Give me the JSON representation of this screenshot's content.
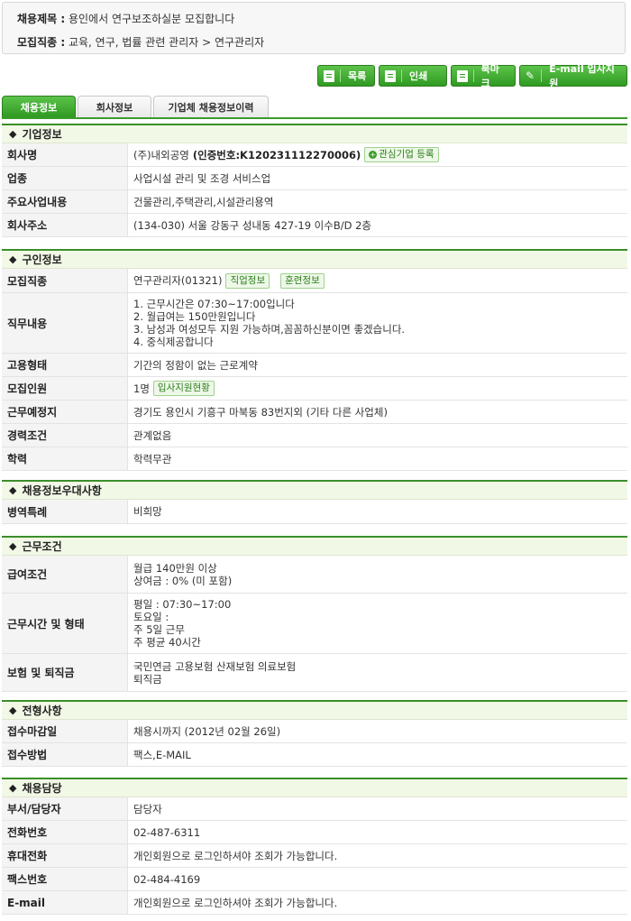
{
  "header": {
    "title_label": "채용제목 :",
    "title_value": "용인에서 연구보조하실분 모집합니다",
    "category_label": "모집직종 :",
    "category_value": "교육, 연구, 법률 관련 관리자 > 연구관리자"
  },
  "toolbar": {
    "list": "목록",
    "print": "인쇄",
    "bookmark": "북마크",
    "email_apply": "E-mail 입사지원"
  },
  "tabs": [
    "채용정보",
    "회사정보",
    "기업체 채용정보이력"
  ],
  "company": {
    "heading": "기업정보",
    "name_label": "회사명",
    "name_value": "(주)내외공영",
    "cert_no": "(인증번호:K120231112270006)",
    "fav_btn": "관심기업 등록",
    "industry_label": "업종",
    "industry_value": "사업시설 관리 및 조경 서비스업",
    "business_label": "주요사업내용",
    "business_value": "건물관리,주택관리,시설관리용역",
    "address_label": "회사주소",
    "address_value": "(134-030) 서울 강동구 성내동 427-19 이수B/D 2층"
  },
  "recruit": {
    "heading": "구인정보",
    "job_label": "모집직종",
    "job_value": "연구관리자(01321)",
    "job_tag1": "직업정보",
    "job_tag2": "훈련정보",
    "duty_label": "직무내용",
    "duty_lines": [
      "1. 근무시간은 07:30~17:00입니다",
      "2. 월급여는 150만원입니다",
      "3. 남성과 여성모두 지원 가능하며,꼼꼼하신분이면 좋겠습니다.",
      "4. 중식제공합니다"
    ],
    "type_label": "고용형태",
    "type_value": "기간의 정함이 없는 근로계약",
    "count_label": "모집인원",
    "count_value": "1명",
    "count_tag": "입사지원현황",
    "place_label": "근무예정지",
    "place_value": "경기도 용인시 기흥구 마북동 83번지외 (기타 다른 사업체)",
    "career_label": "경력조건",
    "career_value": "관계없음",
    "edu_label": "학력",
    "edu_value": "학력무관"
  },
  "prefer": {
    "heading": "채용정보우대사항",
    "military_label": "병역특례",
    "military_value": "비희망"
  },
  "work": {
    "heading": "근무조건",
    "pay_label": "급여조건",
    "pay_lines": [
      "월급 140만원 이상",
      "상여금 : 0% (미 포함)"
    ],
    "hours_label": "근무시간 및 형태",
    "hours_lines": [
      "평일 : 07:30~17:00",
      "토요일 :",
      "주 5일 근무",
      "주 평균 40시간"
    ],
    "ins_label": "보험 및 퇴직금",
    "ins_lines": [
      "국민연금 고용보험 산재보험 의료보험",
      "퇴직금"
    ]
  },
  "process": {
    "heading": "전형사항",
    "deadline_label": "접수마감일",
    "deadline_value": "채용시까지 (2012년 02월 26일)",
    "method_label": "접수방법",
    "method_value": "팩스,E-MAIL"
  },
  "contact": {
    "heading": "채용담당",
    "dept_label": "부서/담당자",
    "dept_value": "담당자",
    "phone_label": "전화번호",
    "phone_value": "02-487-6311",
    "mobile_label": "휴대전화",
    "mobile_value": "개인회원으로 로그인하셔야 조회가 가능합니다.",
    "fax_label": "팩스번호",
    "fax_value": "02-484-4169",
    "email_label": "E-mail",
    "email_value": "개인회원으로 로그인하셔야 조회가 가능합니다."
  }
}
